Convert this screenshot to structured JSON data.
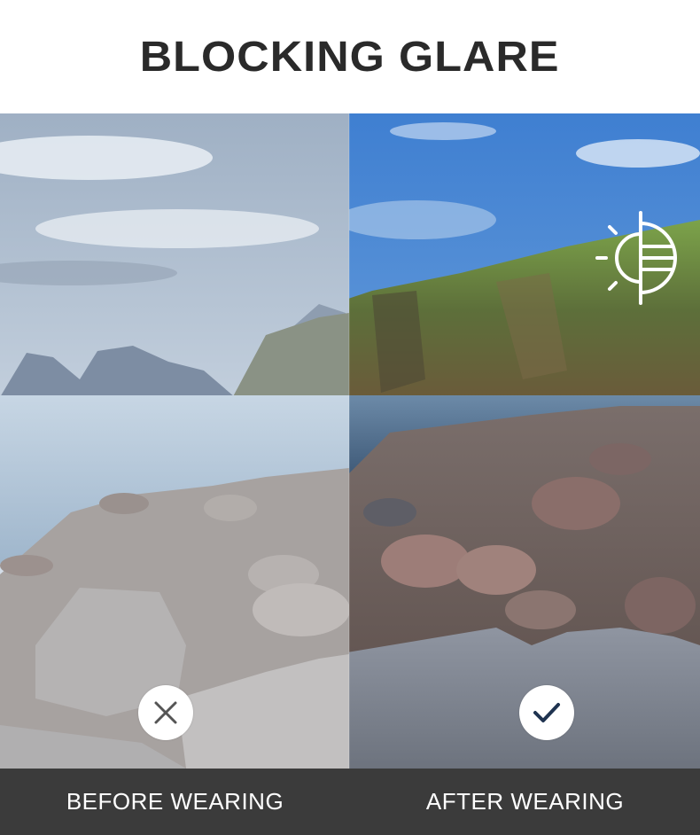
{
  "title": "BLOCKING GLARE",
  "labels": {
    "before": "BEFORE WEARING",
    "after": "AFTER WEARING"
  },
  "icons": {
    "glare": "sun-contrast-icon",
    "before": "x-mark-icon",
    "after": "checkmark-icon"
  },
  "colors": {
    "title_text": "#2a2a2a",
    "bar_background": "#3b3b3b",
    "bar_text": "#ffffff"
  }
}
